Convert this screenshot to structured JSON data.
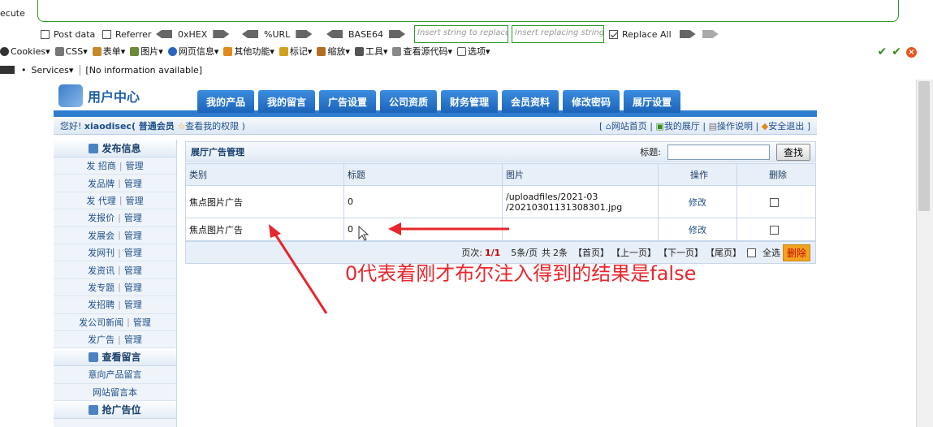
{
  "hackbar": {
    "execute_label": "ecute",
    "post_data": "Post data",
    "referrer": "Referrer",
    "hex": "0xHEX",
    "url": "%URL",
    "base64": "BASE64",
    "insert_placeholder": "Insert string to replace",
    "replacing_placeholder": "Insert replacing string",
    "replace_all": "Replace All"
  },
  "webdev_bar": {
    "items": [
      "Cookies▾",
      "CSS▾",
      "表单▾",
      "图片▾",
      "网页信息▾",
      "其他功能▾",
      "标记▾",
      "缩放▾",
      "工具▾",
      "查看源代码▾",
      "选项▾"
    ]
  },
  "status_bar": {
    "services": "Services▾",
    "info": "[No information available]"
  },
  "member": {
    "logo_text": "用户中心",
    "tabs": [
      "我的产品",
      "我的留言",
      "广告设置",
      "公司资质",
      "财务管理",
      "会员资料",
      "修改密码",
      "展厅设置"
    ],
    "greeting": "您好!",
    "username": "xiaodisec",
    "level": "( 普通会员",
    "rights": "查看我的权限 )",
    "links": [
      "网站首页",
      "我的展厅",
      "操作说明",
      "安全退出"
    ]
  },
  "sidebar": {
    "publish_title": "发布信息",
    "rows": [
      {
        "pub": "发 招商",
        "mgr": "管理"
      },
      {
        "pub": "发品牌",
        "mgr": "管理"
      },
      {
        "pub": "发 代理",
        "mgr": "管理"
      },
      {
        "pub": "发报价",
        "mgr": "管理"
      },
      {
        "pub": "发展会",
        "mgr": "管理"
      },
      {
        "pub": "发网刊",
        "mgr": "管理"
      },
      {
        "pub": "发资讯",
        "mgr": "管理"
      },
      {
        "pub": "发专题",
        "mgr": "管理"
      },
      {
        "pub": "发招聘",
        "mgr": "管理"
      },
      {
        "pub": "发公司新闻",
        "mgr": "管理"
      },
      {
        "pub": "发广告",
        "mgr": "管理"
      }
    ],
    "messages_title": "查看留言",
    "message_rows": [
      "意向产品留言",
      "网站留言本"
    ],
    "ad_title": "抢广告位"
  },
  "panel": {
    "title": "展厅广告管理",
    "search_label": "标题:",
    "search_button": "查找",
    "columns": [
      "类别",
      "标题",
      "图片",
      "操作",
      "删除"
    ],
    "rows": [
      {
        "category": "焦点图片广告",
        "title": "0",
        "image_line1": "/uploadfiles/2021-03",
        "image_line2": "/20210301131308301.jpg",
        "action": "修改"
      },
      {
        "category": "焦点图片广告",
        "title": "0",
        "image_line1": "",
        "image_line2": "",
        "action": "修改"
      }
    ],
    "pager": {
      "page_label": "页次:",
      "page": "1/1",
      "per_page": "5条/页",
      "total": "共",
      "total_count": "2条",
      "first": "【首页】",
      "prev": "【上一页】",
      "next": "【下一页】",
      "last": "【尾页】",
      "select_all": "全选",
      "delete": "删除"
    }
  },
  "annotation": "0代表着刚才布尔注入得到的结果是false",
  "colors": {
    "accent": "#1b64b8",
    "annotation": "#e8262c",
    "hackbar_green": "#2e9a2e"
  }
}
